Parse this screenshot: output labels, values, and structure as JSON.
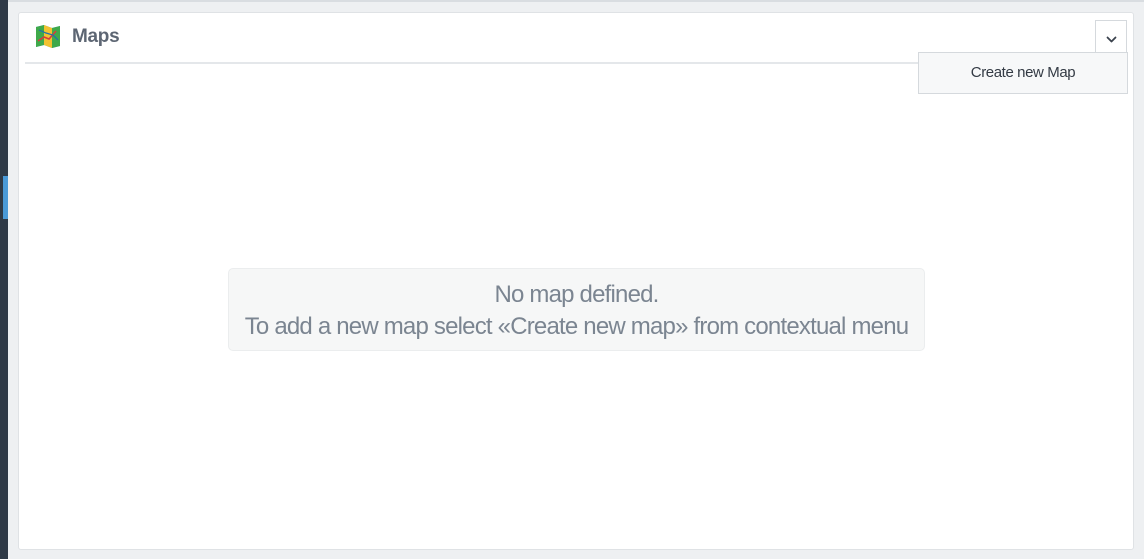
{
  "panel": {
    "title": "Maps",
    "icon": "map-icon"
  },
  "menu": {
    "toggle_icon": "chevron-down-icon",
    "items": [
      {
        "label": "Create new Map"
      }
    ]
  },
  "empty_state": {
    "line1": "No map defined.",
    "line2": "To add a new map select «Create new map» from contextual menu"
  },
  "colors": {
    "rail": "#2f3a47",
    "rail_accent": "#4a9ad8",
    "title_text": "#5d6673",
    "empty_text": "#7b8591"
  }
}
